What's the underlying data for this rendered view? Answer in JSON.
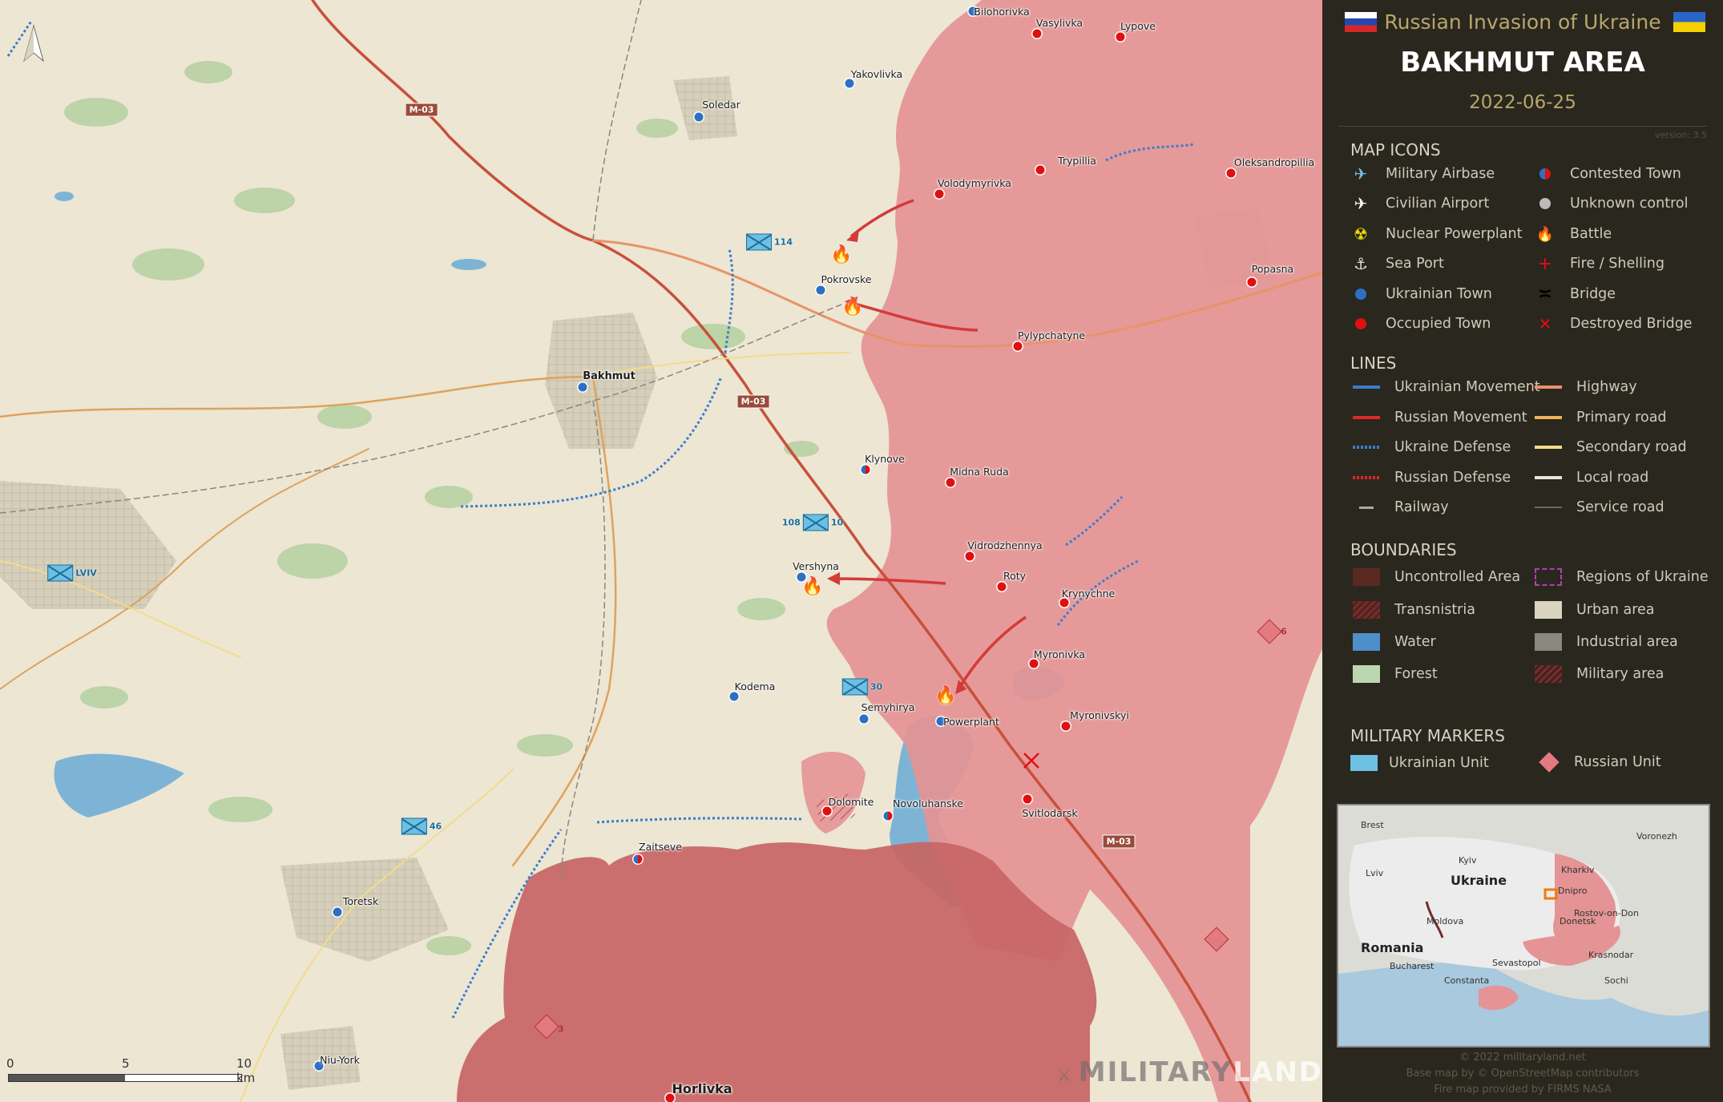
{
  "header": {
    "title": "Russian Invasion of Ukraine",
    "area": "BAKHMUT AREA",
    "date": "2022-06-25",
    "version": "version: 3.5"
  },
  "colors": {
    "occupied": "#e07e7e",
    "occupied_dark": "#b94f4f",
    "ukraine_blue": "#2d6fc4",
    "russia_red": "#e01010",
    "panel_bg": "#2a271e"
  },
  "map": {
    "towns": [
      {
        "name": "Bilohorivka",
        "status": "ukrainian"
      },
      {
        "name": "Vasylivka",
        "status": "occupied"
      },
      {
        "name": "Lypove",
        "status": "occupied"
      },
      {
        "name": "Yakovlivka",
        "status": "ukrainian"
      },
      {
        "name": "Soledar",
        "status": "ukrainian"
      },
      {
        "name": "Trypillia",
        "status": "occupied"
      },
      {
        "name": "Oleksandropillia",
        "status": "occupied"
      },
      {
        "name": "Volodymyrivka",
        "status": "occupied"
      },
      {
        "name": "Popasna",
        "status": "occupied"
      },
      {
        "name": "Pokrovske",
        "status": "ukrainian"
      },
      {
        "name": "Pylypchatyne",
        "status": "occupied"
      },
      {
        "name": "Bakhmut",
        "status": "ukrainian"
      },
      {
        "name": "Klynove",
        "status": "contested"
      },
      {
        "name": "Midna Ruda",
        "status": "occupied"
      },
      {
        "name": "Vidrodzhennya",
        "status": "occupied"
      },
      {
        "name": "Vershyna",
        "status": "ukrainian"
      },
      {
        "name": "Roty",
        "status": "occupied"
      },
      {
        "name": "Krynychne",
        "status": "occupied"
      },
      {
        "name": "Myronivka",
        "status": "occupied"
      },
      {
        "name": "Kodema",
        "status": "ukrainian"
      },
      {
        "name": "Semyhirya",
        "status": "ukrainian"
      },
      {
        "name": "Powerplant",
        "status": "ukrainian"
      },
      {
        "name": "Myronivskyi",
        "status": "occupied"
      },
      {
        "name": "Dolomite",
        "status": "occupied"
      },
      {
        "name": "Novoluhanske",
        "status": "contested"
      },
      {
        "name": "Svitlodarsk",
        "status": "occupied"
      },
      {
        "name": "Zaitseve",
        "status": "contested"
      },
      {
        "name": "Toretsk",
        "status": "ukrainian"
      },
      {
        "name": "Niu-York",
        "status": "ukrainian"
      },
      {
        "name": "Horlivka",
        "status": "occupied"
      }
    ],
    "road_labels": [
      "M-03",
      "M-03",
      "M-03"
    ],
    "ukrainian_units": [
      "114",
      "108",
      "10",
      "30",
      "46",
      "LVIV"
    ],
    "russian_units": [
      "6",
      "3",
      ""
    ],
    "battles": 5,
    "scale": {
      "zero": "0",
      "mid": "5",
      "end": "10 km"
    },
    "watermark": {
      "a": "MILITARY",
      "b": "LAND"
    }
  },
  "legend": {
    "map_icons_title": "MAP ICONS",
    "map_icons_left": [
      {
        "label": "Military Airbase",
        "icon": "airbase-icon"
      },
      {
        "label": "Civilian Airport",
        "icon": "airport-icon"
      },
      {
        "label": "Nuclear Powerplant",
        "icon": "nuclear-icon"
      },
      {
        "label": "Sea Port",
        "icon": "anchor-icon"
      },
      {
        "label": "Ukrainian Town",
        "icon": "blue-dot-icon"
      },
      {
        "label": "Occupied Town",
        "icon": "red-dot-icon"
      }
    ],
    "map_icons_right": [
      {
        "label": "Contested Town",
        "icon": "half-dot-icon"
      },
      {
        "label": "Unknown control",
        "icon": "gray-dot-icon"
      },
      {
        "label": "Battle",
        "icon": "fire-icon"
      },
      {
        "label": "Fire / Shelling",
        "icon": "cross-icon"
      },
      {
        "label": "Bridge",
        "icon": "bridge-icon"
      },
      {
        "label": "Destroyed Bridge",
        "icon": "destroyed-bridge-icon"
      }
    ],
    "lines_title": "LINES",
    "lines_left": [
      {
        "label": "Ukrainian Movement",
        "color": "#3a7ccc"
      },
      {
        "label": "Russian Movement",
        "color": "#e02828"
      },
      {
        "label": "Ukraine Defense",
        "color": "#3a7ccc"
      },
      {
        "label": "Russian Defense",
        "color": "#e02828"
      },
      {
        "label": "Railway",
        "color": "#aaaaaa"
      }
    ],
    "lines_right": [
      {
        "label": "Highway",
        "color": "#e8936a"
      },
      {
        "label": "Primary road",
        "color": "#f0b25a"
      },
      {
        "label": "Secondary road",
        "color": "#f2dc8a"
      },
      {
        "label": "Local road",
        "color": "#e8e4d8"
      },
      {
        "label": "Service road",
        "color": "#6b665a"
      }
    ],
    "boundaries_title": "BOUNDARIES",
    "boundaries_left": [
      {
        "label": "Uncontrolled Area",
        "color": "#5a2a22"
      },
      {
        "label": "Transnistria",
        "color": "#7a2a2a"
      },
      {
        "label": "Water",
        "color": "#4d8fc8"
      },
      {
        "label": "Forest",
        "color": "#bcd6b0"
      }
    ],
    "boundaries_right": [
      {
        "label": "Regions of Ukraine",
        "color": "#b040b0"
      },
      {
        "label": "Urban area",
        "color": "#d9d3bf"
      },
      {
        "label": "Industrial area",
        "color": "#8a8780"
      },
      {
        "label": "Military area",
        "color": "#7a2a2a"
      }
    ],
    "markers_title": "MILITARY MARKERS",
    "markers": [
      {
        "label": "Ukrainian Unit",
        "color": "#6ec0e3"
      },
      {
        "label": "Russian Unit",
        "color": "#e37a80"
      }
    ]
  },
  "minimap": {
    "labels": [
      "Brest",
      "Voronezh",
      "Kyiv",
      "Kharkiv",
      "Lviv",
      "Ukraine",
      "Dnipro",
      "Donetsk",
      "Moldova",
      "Rostov-on-Don",
      "Romania",
      "Krasnodar",
      "Sevastopol",
      "Bucharest",
      "Constanta",
      "Sochi"
    ]
  },
  "credits": [
    "© 2022 militaryland.net",
    "Base map by © OpenStreetMap contributors",
    "Fire map provided by FIRMS NASA"
  ]
}
